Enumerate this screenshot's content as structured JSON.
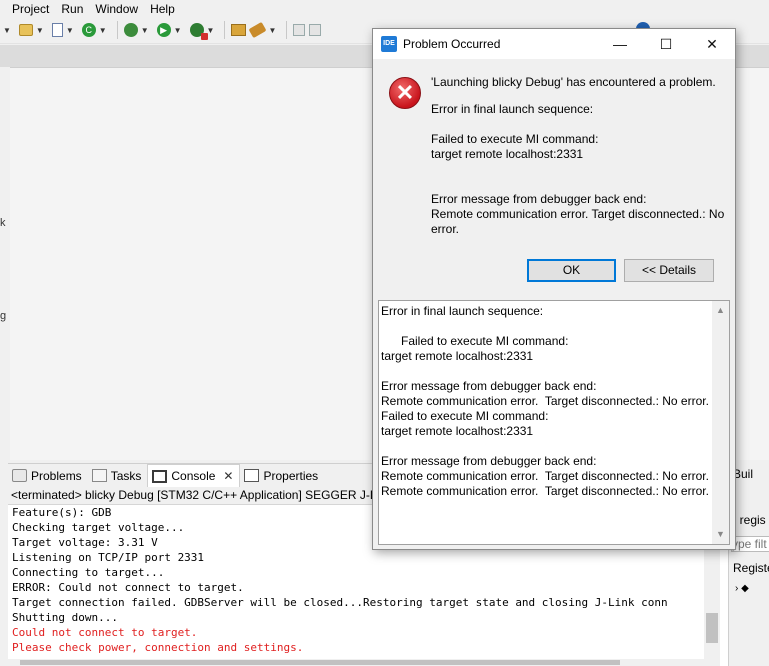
{
  "menu": [
    "Project",
    "Run",
    "Window",
    "Help"
  ],
  "editor": {
    "gutter_chars": [
      "k",
      "g"
    ]
  },
  "bottom_tabs": [
    {
      "label": "Problems",
      "icon": "problems-icon"
    },
    {
      "label": "Tasks",
      "icon": "tasks-icon"
    },
    {
      "label": "Console",
      "icon": "console-icon",
      "active": true
    },
    {
      "label": "Properties",
      "icon": "properties-icon"
    }
  ],
  "console": {
    "header": "<terminated> blicky Debug [STM32 C/C++ Application] SEGGER J-Link",
    "lines": [
      {
        "text": "Feature(s): GDB",
        "error": false
      },
      {
        "text": "Checking target voltage...",
        "error": false
      },
      {
        "text": "Target voltage: 3.31 V",
        "error": false
      },
      {
        "text": "Listening on TCP/IP port 2331",
        "error": false
      },
      {
        "text": "Connecting to target...",
        "error": false
      },
      {
        "text": "ERROR: Could not connect to target.",
        "error": false
      },
      {
        "text": "Target connection failed. GDBServer will be closed...Restoring target state and closing J-Link conn",
        "error": false
      },
      {
        "text": "Shutting down...",
        "error": false
      },
      {
        "text": "Could not connect to target.",
        "error": true
      },
      {
        "text": "Please check power, connection and settings.",
        "error": true
      }
    ]
  },
  "right_panel": {
    "tab": "Buil",
    "line1": "ll regis",
    "filter": "ype filt",
    "registers": "Registe"
  },
  "dialog": {
    "app_badge": "IDE",
    "title": "Problem Occurred",
    "headline": "'Launching blicky Debug' has encountered a problem.",
    "message": [
      "Error in final launch sequence:",
      "",
      "Failed to execute MI command:",
      "target remote localhost:2331",
      "",
      "",
      "Error message from debugger back end:",
      "Remote communication error.  Target disconnected.: No",
      "error."
    ],
    "ok_label": "OK",
    "details_label": "<< Details",
    "details": [
      "Error in final launch sequence:",
      "",
      "      Failed to execute MI command:",
      "target remote localhost:2331",
      "",
      "Error message from debugger back end:",
      "Remote communication error.  Target disconnected.: No error.",
      "Failed to execute MI command:",
      "target remote localhost:2331",
      "",
      "Error message from debugger back end:",
      "Remote communication error.  Target disconnected.: No error.",
      "Remote communication error.  Target disconnected.: No error."
    ]
  }
}
